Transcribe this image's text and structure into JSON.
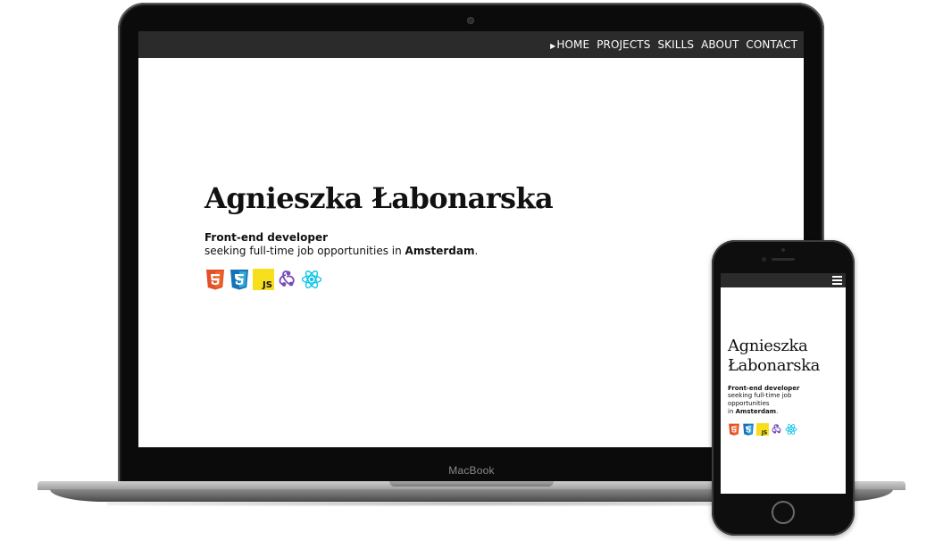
{
  "laptop": {
    "brand": "MacBook",
    "nav": [
      {
        "label": "HOME",
        "active": true
      },
      {
        "label": "PROJECTS"
      },
      {
        "label": "SKILLS"
      },
      {
        "label": "ABOUT"
      },
      {
        "label": "CONTACT"
      }
    ]
  },
  "profile": {
    "name": "Agnieszka Łabonarska",
    "name_line1": "Agnieszka",
    "name_line2": "Łabonarska",
    "role": "Front-end developer",
    "desc_prefix": "seeking full-time job opportunities in ",
    "desc_city": "Amsterdam",
    "desc_suffix": ".",
    "mobile_desc_line1": "seeking full-time job opportunities",
    "mobile_desc_line2_prefix": "in ",
    "tech_icons": [
      "html5-icon",
      "css3-icon",
      "javascript-icon",
      "redux-icon",
      "react-icon"
    ],
    "js_label": "JS"
  },
  "colors": {
    "nav_bg": "#2b2b2b",
    "html5": "#e34f26",
    "css3": "#1572b6",
    "js": "#f7df1e",
    "redux": "#764abc",
    "react": "#61dafb"
  }
}
